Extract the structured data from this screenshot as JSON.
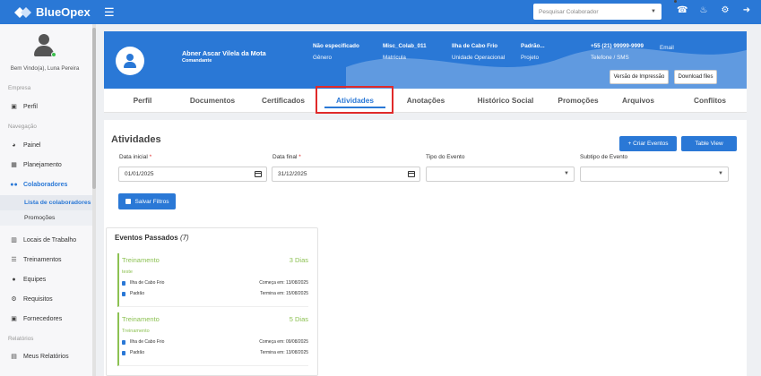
{
  "app": {
    "name": "BlueOpex"
  },
  "topbar": {
    "search_placeholder": "Pesquisar Colaborador",
    "icons": [
      "headset-icon",
      "bell-icon",
      "gear-icon",
      "logout-icon"
    ]
  },
  "sidebar": {
    "welcome": "Bem Vindo(a), Luna Pereira",
    "sections": {
      "empresa": "Empresa",
      "navegacao": "Navegação",
      "relatorios": "Relatórios"
    },
    "items": {
      "perfil": "Perfil",
      "painel": "Painel",
      "planejamento": "Planejamento",
      "colaboradores": "Colaboradores",
      "lista": "Lista de colaboradores",
      "promocoes": "Promoções",
      "locais": "Locais de Trabalho",
      "treinamentos": "Treinamentos",
      "equipes": "Equipes",
      "requisitos": "Requisitos",
      "fornecedores": "Fornecedores",
      "meus_relatorios": "Meus Relatórios"
    }
  },
  "profile": {
    "name": "Abner Ascar Vilela da Mota",
    "role": "Comandante",
    "fields": [
      {
        "value": "Não especificado",
        "label": "Gênero"
      },
      {
        "value": "Misc_Colab_011",
        "label": "Matrícula"
      },
      {
        "value": "Ilha de Cabo Frio",
        "label": "Unidade Operacional"
      },
      {
        "value": "Padrão...",
        "label": "Projeto"
      },
      {
        "value": "+55 (21) 99999-9999",
        "label": "Telefone / SMS"
      },
      {
        "value": "Email",
        "label": ""
      }
    ],
    "print_button": "Versão de Impressão",
    "download_button": "Download files"
  },
  "tabs": [
    "Perfil",
    "Documentos",
    "Certificados",
    "Atividades",
    "Anotações",
    "Histórico Social",
    "Promoções",
    "Arquivos",
    "Conflitos"
  ],
  "activities": {
    "title": "Atividades",
    "create_button": "+ Criar Eventos",
    "table_view_button": "Table View",
    "filters": {
      "start_label": "Data inicial",
      "start_value": "01/01/2025",
      "end_label": "Data final",
      "end_value": "31/12/2025",
      "type_label": "Tipo do Evento",
      "subtype_label": "Subtipo de Evento",
      "required_mark": "*"
    },
    "save_filters_button": "Salvar Filtros"
  },
  "past_events": {
    "title": "Eventos Passados",
    "count": "(7)",
    "items": [
      {
        "type": "Treinamento",
        "days": "3 Dias",
        "description": "teste",
        "location": "Ilha de Cabo Frio",
        "project": "Padrão",
        "start": "Começa em: 13/08/2025",
        "end": "Termina em: 15/08/2025"
      },
      {
        "type": "Treinamento",
        "days": "5 Dias",
        "description": "Treinamento",
        "location": "Ilha de Cabo Frio",
        "project": "Padrão",
        "start": "Começa em: 09/08/2025",
        "end": "Termina em: 13/08/2025"
      }
    ]
  },
  "colors": {
    "primary": "#2a78d6",
    "event_green": "#8cc152",
    "highlight_red": "#e02a2a"
  }
}
